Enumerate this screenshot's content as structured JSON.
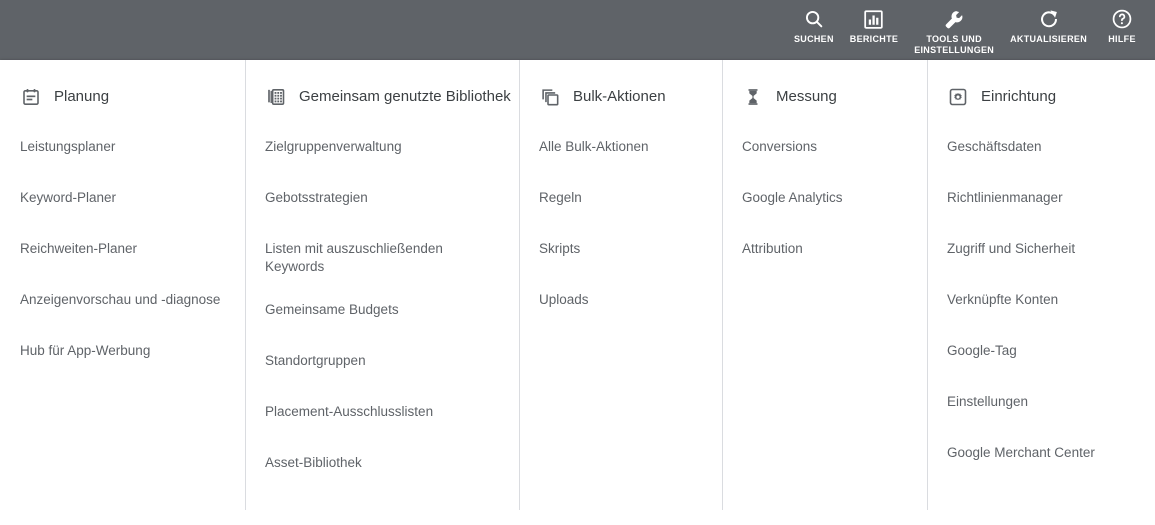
{
  "toolbar": {
    "items": [
      {
        "label": "SUCHEN",
        "icon": "search-icon",
        "name": "toolbar-search"
      },
      {
        "label": "BERICHTE",
        "icon": "reports-bar-chart-icon",
        "name": "toolbar-reports"
      },
      {
        "label": "TOOLS UND\nEINSTELLUNGEN",
        "icon": "wrench-tools-icon",
        "name": "toolbar-tools-and-settings"
      },
      {
        "label": "AKTUALISIEREN",
        "icon": "refresh-icon",
        "name": "toolbar-refresh"
      },
      {
        "label": "HILFE",
        "icon": "help-circle-icon",
        "name": "toolbar-help"
      }
    ]
  },
  "menu": {
    "columns": [
      {
        "title": "Planung",
        "icon": "calendar-note-icon",
        "items": [
          "Leistungsplaner",
          "Keyword-Planer",
          "Reichweiten-Planer",
          "Anzeigenvorschau und -diagnose",
          "Hub für App-Werbung"
        ]
      },
      {
        "title": "Gemeinsam genutzte Bibliothek",
        "icon": "library-grid-icon",
        "items": [
          "Zielgruppenverwaltung",
          "Gebotsstrategien",
          "Listen mit auszuschließenden Keywords",
          "Gemeinsame Budgets",
          "Standortgruppen",
          "Placement-Ausschlusslisten",
          "Asset-Bibliothek"
        ]
      },
      {
        "title": "Bulk-Aktionen",
        "icon": "stacked-layers-icon",
        "items": [
          "Alle Bulk-Aktionen",
          "Regeln",
          "Skripts",
          "Uploads"
        ]
      },
      {
        "title": "Messung",
        "icon": "hourglass-icon",
        "items": [
          "Conversions",
          "Google Analytics",
          "Attribution"
        ]
      },
      {
        "title": "Einrichtung",
        "icon": "gear-square-icon",
        "items": [
          "Geschäftsdaten",
          "Richtlinienmanager",
          "Zugriff und Sicherheit",
          "Verknüpfte Konten",
          "Google-Tag",
          "Einstellungen",
          "Google Merchant Center"
        ]
      }
    ]
  },
  "colors": {
    "toolbar_background": "#5f6368",
    "panel_background": "#ffffff",
    "divider": "#dadce0",
    "heading_text": "#3c4043",
    "item_text": "#5f6368"
  }
}
